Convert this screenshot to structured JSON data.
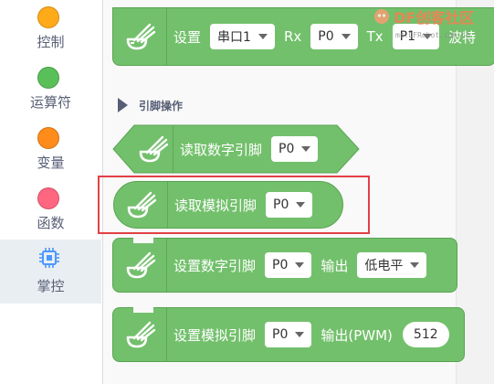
{
  "sidebar": {
    "categories": [
      {
        "label": "控制",
        "color": "#ffab19"
      },
      {
        "label": "运算符",
        "color": "#59c059"
      },
      {
        "label": "变量",
        "color": "#ff8c1a"
      },
      {
        "label": "函数",
        "color": "#ff6680"
      },
      {
        "label": "掌控",
        "color": "#4c97ff"
      }
    ]
  },
  "workspace": {
    "section_title": "引脚操作",
    "serial_block": {
      "label": "设置",
      "port": "串口1",
      "rx_label": "Rx",
      "rx_value": "P0",
      "tx_label": "Tx",
      "tx_value": "P1",
      "baud_label": "波特"
    },
    "read_digital_block": {
      "label": "读取数字引脚",
      "pin": "P0"
    },
    "read_analog_block": {
      "label": "读取模拟引脚",
      "pin": "P0"
    },
    "set_digital_block": {
      "label": "设置数字引脚",
      "pin": "P0",
      "output_label": "输出",
      "level": "低电平"
    },
    "set_analog_block": {
      "label": "设置模拟引脚",
      "pin": "P0",
      "output_label": "输出(PWM)",
      "value": "512"
    }
  },
  "watermark": {
    "brand": "DF创客社区",
    "url": "mc.DFRobot.com.cn"
  },
  "colors": {
    "block_green": "#73c06c",
    "highlight_red": "#e24045"
  },
  "icons": [
    "extension-icon",
    "chip-icon",
    "caret-down-icon"
  ]
}
